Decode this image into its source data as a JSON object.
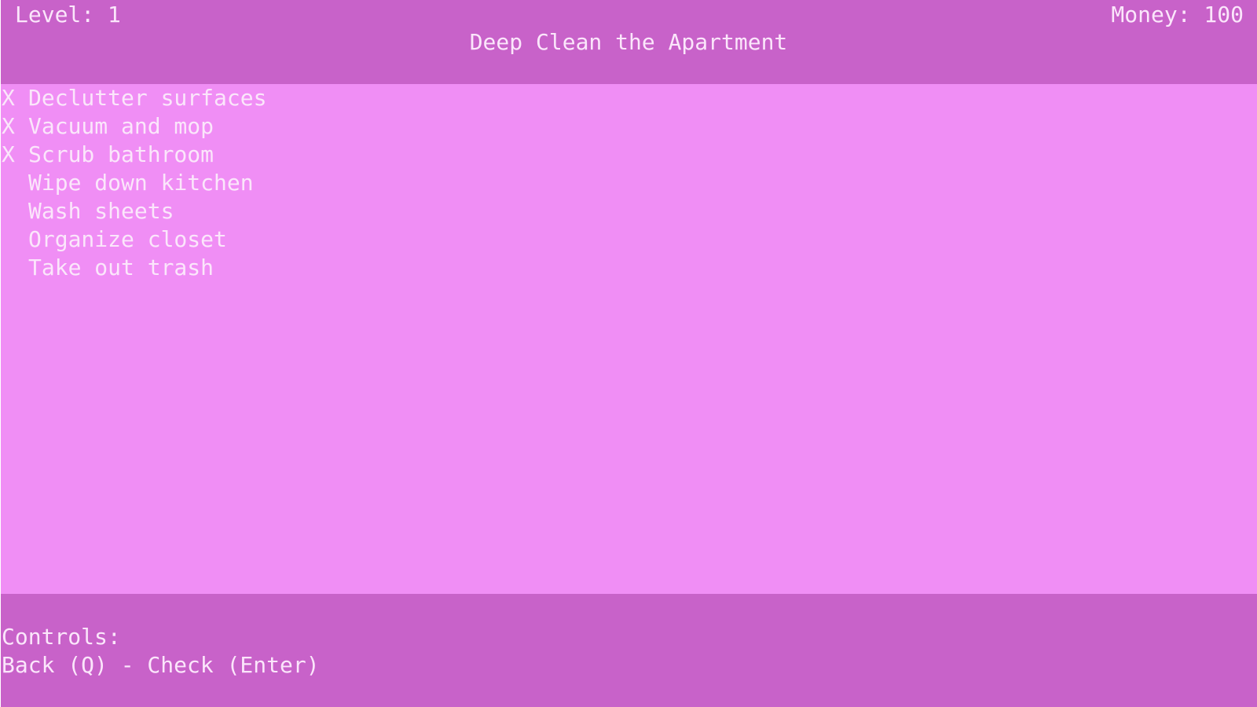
{
  "hud": {
    "level_text": "Level: 1",
    "money_text": "Money: 100",
    "title": "Deep Clean the Apartment"
  },
  "tasks": [
    {
      "mark": "X",
      "label": "Declutter surfaces",
      "done": true
    },
    {
      "mark": "X",
      "label": "Vacuum and mop",
      "done": true
    },
    {
      "mark": "X",
      "label": "Scrub bathroom",
      "done": true
    },
    {
      "mark": "",
      "label": "Wipe down kitchen",
      "done": false
    },
    {
      "mark": "",
      "label": "Wash sheets",
      "done": false
    },
    {
      "mark": "",
      "label": "Organize closet",
      "done": false
    },
    {
      "mark": "",
      "label": "Take out trash",
      "done": false
    }
  ],
  "controls": {
    "title": "Controls:",
    "hint": "Back (Q) - Check (Enter)"
  },
  "colors": {
    "frame": "#c862c9",
    "panel": "#f08ef5",
    "text": "#fbe6fb"
  }
}
